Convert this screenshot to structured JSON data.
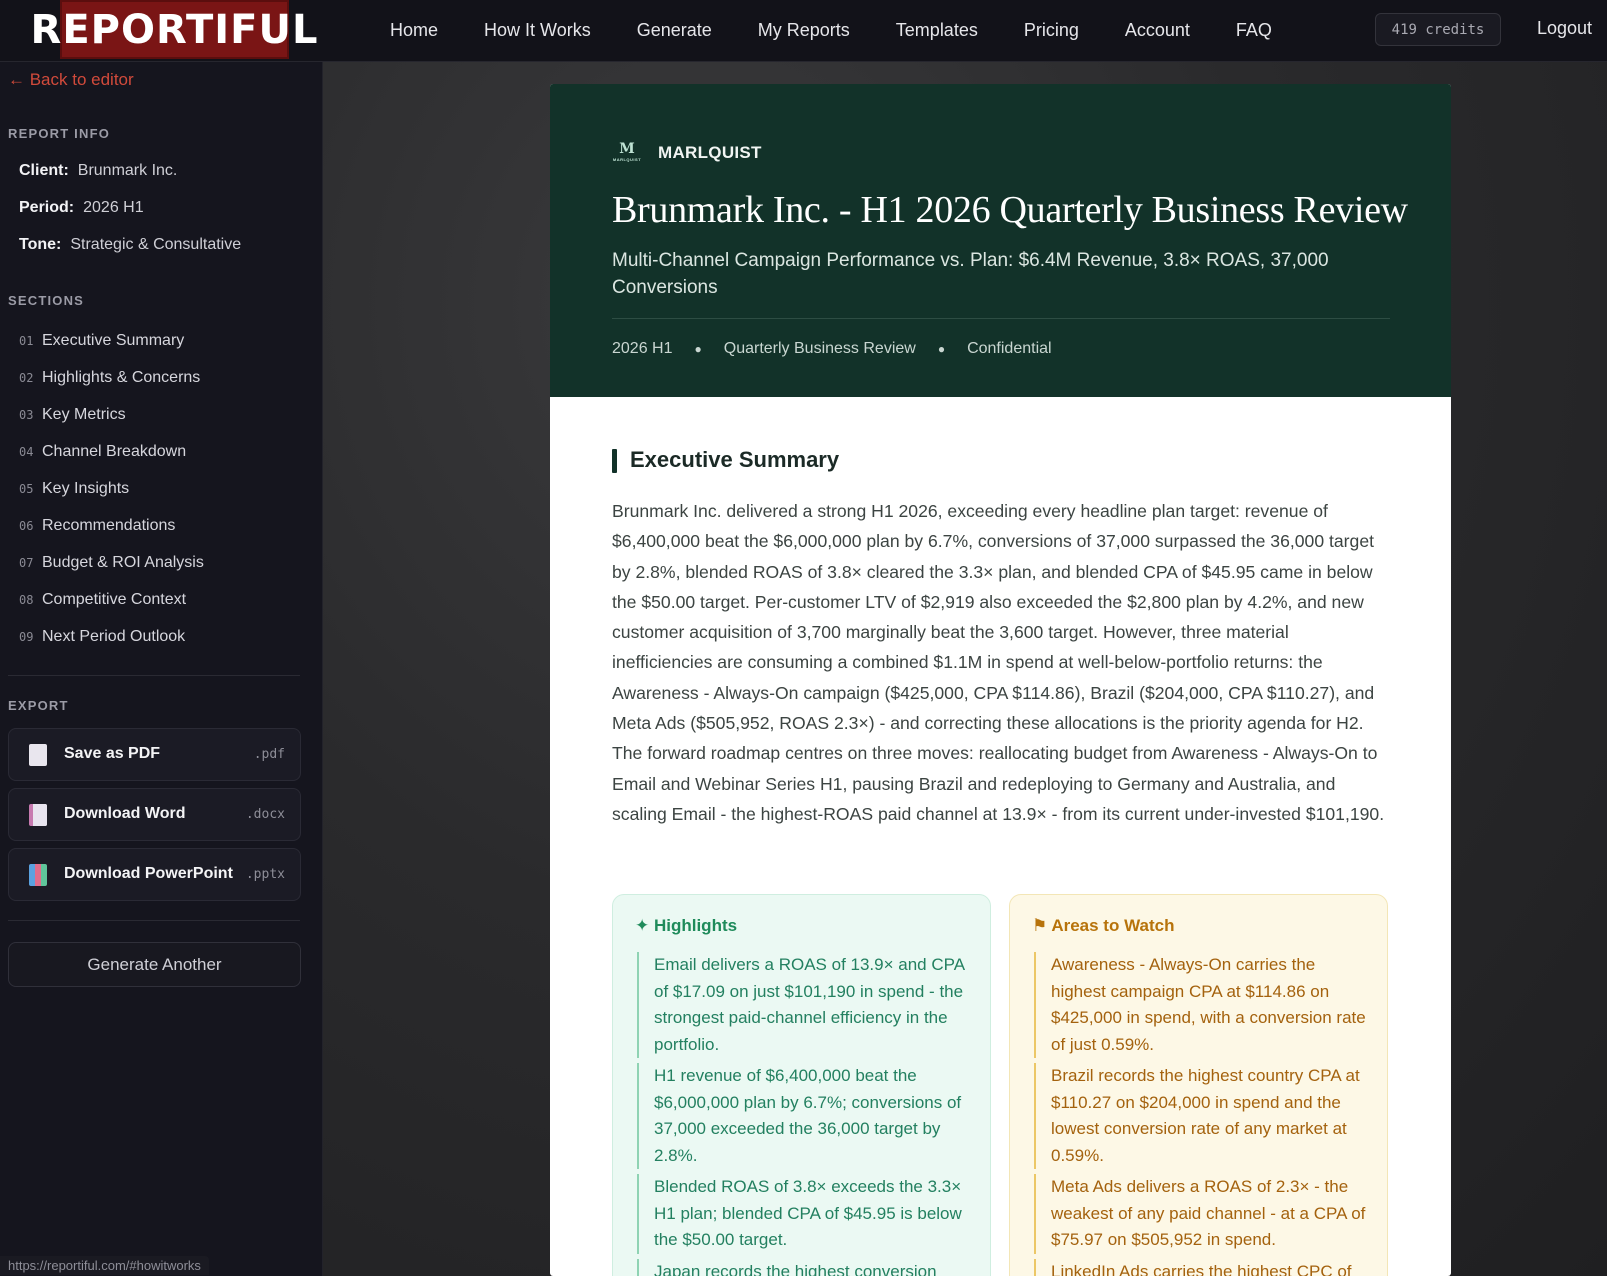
{
  "app": {
    "logo_text": "REPORTIFUL",
    "nav": [
      "Home",
      "How It Works",
      "Generate",
      "My Reports",
      "Templates",
      "Pricing",
      "Account",
      "FAQ"
    ],
    "credits": "419 credits",
    "logout": "Logout"
  },
  "sidebar": {
    "back_link": "← Back to editor",
    "report_info_heading": "REPORT INFO",
    "info": [
      {
        "label": "Client:",
        "value": "Brunmark Inc."
      },
      {
        "label": "Period:",
        "value": "2026 H1"
      },
      {
        "label": "Tone:",
        "value": "Strategic & Consultative"
      }
    ],
    "sections_heading": "SECTIONS",
    "sections": [
      {
        "num": "01",
        "label": "Executive Summary"
      },
      {
        "num": "02",
        "label": "Highlights & Concerns"
      },
      {
        "num": "03",
        "label": "Key Metrics"
      },
      {
        "num": "04",
        "label": "Channel Breakdown"
      },
      {
        "num": "05",
        "label": "Key Insights"
      },
      {
        "num": "06",
        "label": "Recommendations"
      },
      {
        "num": "07",
        "label": "Budget & ROI Analysis"
      },
      {
        "num": "08",
        "label": "Competitive Context"
      },
      {
        "num": "09",
        "label": "Next Period Outlook"
      }
    ],
    "export_heading": "EXPORT",
    "exports": [
      {
        "label": "Save as PDF",
        "ext": ".pdf",
        "icon": "pdf-file-icon"
      },
      {
        "label": "Download Word",
        "ext": ".docx",
        "icon": "word-file-icon"
      },
      {
        "label": "Download PowerPoint",
        "ext": ".pptx",
        "icon": "powerpoint-file-icon"
      }
    ],
    "generate_another": "Generate Another"
  },
  "status_url": "https://reportiful.com/#howitworks",
  "report": {
    "brand_mark": "M",
    "brand_mark_small": "MARLQUIST",
    "brand_name": "MARLQUIST",
    "title": "Brunmark Inc. - H1 2026 Quarterly Business Review",
    "subtitle": "Multi-Channel Campaign Performance vs. Plan: $6.4M Revenue, 3.8× ROAS, 37,000 Conversions",
    "meta": [
      "2026 H1",
      "Quarterly Business Review",
      "Confidential"
    ],
    "section_title": "Executive Summary",
    "summary": "Brunmark Inc. delivered a strong H1 2026, exceeding every headline plan target: revenue of $6,400,000 beat the $6,000,000 plan by 6.7%, conversions of 37,000 surpassed the 36,000 target by 2.8%, blended ROAS of 3.8× cleared the 3.3× plan, and blended CPA of $45.95 came in below the $50.00 target. Per-customer LTV of $2,919 also exceeded the $2,800 plan by 4.2%, and new customer acquisition of 3,700 marginally beat the 3,600 target. However, three material inefficiencies are consuming a combined $1.1M in spend at well-below-portfolio returns: the Awareness - Always-On campaign ($425,000, CPA $114.86), Brazil ($204,000, CPA $110.27), and Meta Ads ($505,952, ROAS 2.3×) - and correcting these allocations is the priority agenda for H2. The forward roadmap centres on three moves: reallocating budget from Awareness - Always-On to Email and Webinar Series H1, pausing Brazil and redeploying to Germany and Australia, and scaling Email - the highest-ROAS paid channel at 13.9× - from its current under-invested $101,190.",
    "highlights": {
      "title": "✦ Highlights",
      "items": [
        "Email delivers a ROAS of 13.9× and CPA of $17.09 on just $101,190 in spend - the strongest paid-channel efficiency in the portfolio.",
        "H1 revenue of $6,400,000 beat the $6,000,000 plan by 6.7%; conversions of 37,000 exceeded the 36,000 target by 2.8%.",
        "Blended ROAS of 3.8× exceeds the 3.3× H1 plan; blended CPA of $45.95 is below the $50.00 target.",
        "Japan records the highest conversion"
      ]
    },
    "watch": {
      "title": "⚑ Areas to Watch",
      "items": [
        "Awareness - Always-On carries the highest campaign CPA at $114.86 on $425,000 in spend, with a conversion rate of just 0.59%.",
        "Brazil records the highest country CPA at $110.27 on $204,000 in spend and the lowest conversion rate of any market at 0.59%.",
        "Meta Ads delivers a ROAS of 2.3× - the weakest of any paid channel - at a CPA of $75.97 on $505,952 in spend.",
        "LinkedIn Ads carries the highest CPC of"
      ]
    }
  }
}
